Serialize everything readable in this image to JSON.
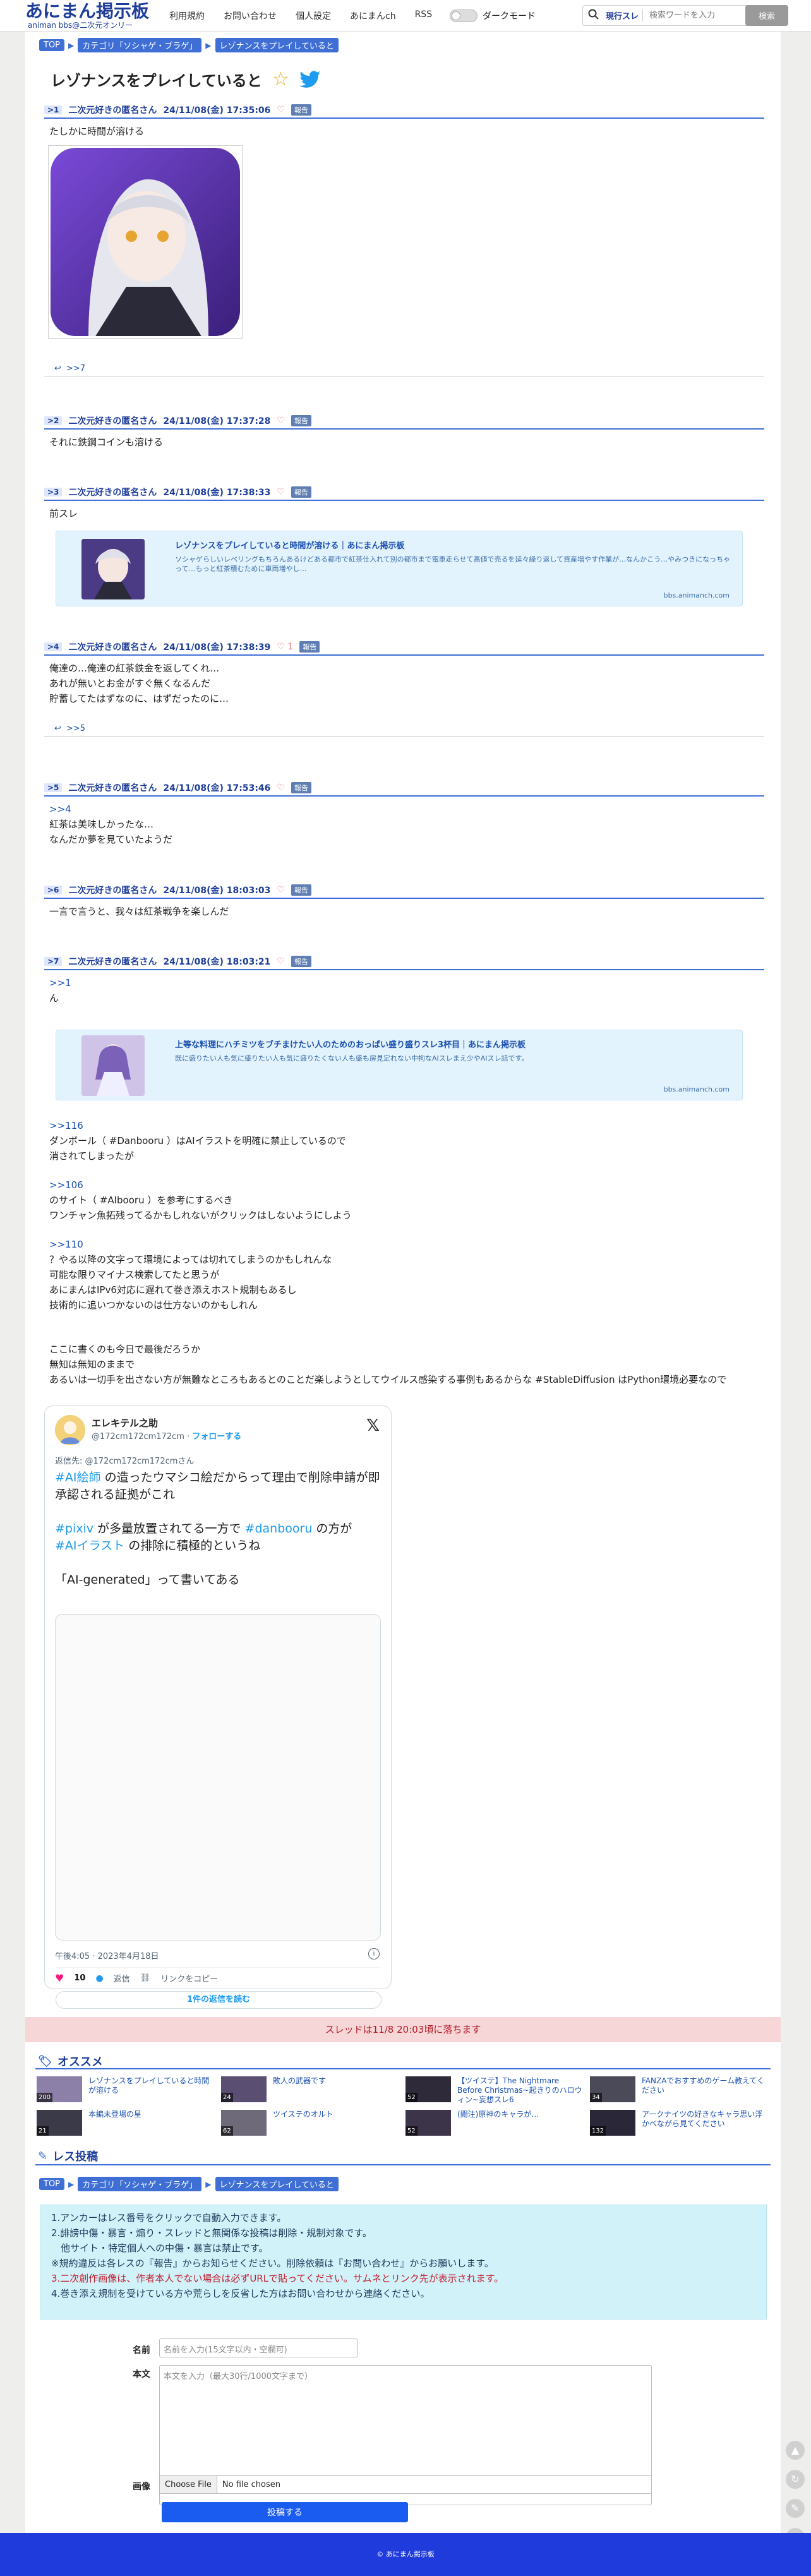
{
  "header": {
    "logo_main": "あにまん掲示板",
    "logo_sub": "animan bbs@二次元オンリー",
    "nav": [
      "利用規約",
      "お問い合わせ",
      "個人設定",
      "あにまんch",
      "RSS"
    ],
    "dark_mode_label": "ダークモード",
    "search_scope": "現行スレ",
    "search_placeholder": "検索ワードを入力",
    "search_button": "検索"
  },
  "breadcrumb": [
    "TOP",
    "カテゴリ「ソシャゲ・ブラゲ」",
    "レゾナンスをプレイしていると"
  ],
  "thread": {
    "title": "レゾナンスをプレイしていると"
  },
  "posts": [
    {
      "num": ">1",
      "name": "二次元好きの匿名さん",
      "date": "24/11/08(金) 17:35:06",
      "likes": "",
      "report": "報告",
      "body": "たしかに時間が溶ける",
      "replies": ">>7"
    },
    {
      "num": ">2",
      "name": "二次元好きの匿名さん",
      "date": "24/11/08(金) 17:37:28",
      "likes": "",
      "report": "報告",
      "body": "それに鉄鋼コインも溶ける"
    },
    {
      "num": ">3",
      "name": "二次元好きの匿名さん",
      "date": "24/11/08(金) 17:38:33",
      "likes": "",
      "report": "報告",
      "body": "前スレ"
    },
    {
      "num": ">4",
      "name": "二次元好きの匿名さん",
      "date": "24/11/08(金) 17:38:39",
      "likes": "1",
      "report": "報告",
      "body": "俺達の…俺達の紅茶鉄金を返してくれ…\nあれが無いとお金がすぐ無くなるんだ\n貯蓄してたはずなのに、はずだったのに…",
      "replies": ">>5"
    },
    {
      "num": ">5",
      "name": "二次元好きの匿名さん",
      "date": "24/11/08(金) 17:53:46",
      "likes": "",
      "report": "報告",
      "anchor": ">>4",
      "body": "紅茶は美味しかったな…\nなんだか夢を見ていたようだ"
    },
    {
      "num": ">6",
      "name": "二次元好きの匿名さん",
      "date": "24/11/08(金) 18:03:03",
      "likes": "",
      "report": "報告",
      "body": "一言で言うと、我々は紅茶戦争を楽しんだ"
    },
    {
      "num": ">7",
      "name": "二次元好きの匿名さん",
      "date": "24/11/08(金) 18:03:21",
      "likes": "",
      "report": "報告",
      "anchor": ">>1",
      "body": "ん"
    }
  ],
  "card1": {
    "title": "レゾナンスをプレイしていると時間が溶ける｜あにまん掲示板",
    "desc": "ソシャゲらしいレベリングもちろんあるけどある都市で紅茶仕入れて別の都市まで電車走らせて高値で売るを延々繰り返して資産増やす作業が…なんかこう…やみつきになっちゃって…もっと紅茶積むために車両増やし…",
    "domain": "bbs.animanch.com"
  },
  "card2": {
    "title": "上等な料理にハチミツをブチまけたい人のためのおっぱい盛り盛りスレ3杯目｜あにまん掲示板",
    "desc": "既に盛りたい人も気に盛りたい人も気に盛りたくない人も盛も房見定れない中拘なAIスレまえ少やAIスレ話です。",
    "domain": "bbs.animanch.com"
  },
  "post7_extra": [
    {
      "anchor": ">>116",
      "lines": "ダンボール（ #Danbooru ）はAIイラストを明確に禁止しているので\n消されてしまったが"
    },
    {
      "anchor": ">>106",
      "lines": "のサイト（ #AIbooru ）を参考にするべき\nワンチャン魚拓残ってるかもしれないがクリックはしないようにしよう"
    },
    {
      "anchor": ">>110",
      "lines": "？やる以降の文字って環境によっては切れてしまうのかもしれんな\n可能な限りマイナス検索してたと思うが\nあにまんはIPv6対応に遅れて巻き添えホスト規制もあるし\n技術的に追いつかないのは仕方ないのかもしれん"
    },
    {
      "anchor": "",
      "lines": "ここに書くのも今日で最後だろうか\n無知は無知のままで\nあるいは一切手を出さない方が無難なところもあるとのことだ楽しようとしてウイルス感染する事例もあるからな #StableDiffusion はPython環境必要なので"
    }
  ],
  "tweet": {
    "name": "エレキテル之助",
    "handle": "@172cm172cm172cm",
    "follow": "フォローする",
    "reply_to_label": "返信先:",
    "reply_to": "@172cm172cm172cmさん",
    "tag_aieshi": "#AI絵師",
    "text1": " の造ったウマシコ絵だからって理由で削除申請が即承認される証拠がこれ",
    "tag_pixiv": "#pixiv",
    "text2": " が多量放置されてる一方で ",
    "tag_danbooru": "#danbooru",
    "text3": " の方が",
    "tag_aiillust": "#AIイラスト",
    "text4": " の排除に積極的というね",
    "quote": "「AI-generated」って書いてある",
    "time": "午後4:05 · 2023年4月18日",
    "likes": "10",
    "reply_label": "返信",
    "copy_label": "リンクをコピー",
    "read_replies": "1件の返信を読む"
  },
  "expire_notice": "スレッドは11/8 20:03頃に落ちます",
  "recommend": {
    "heading": "オススメ",
    "items": [
      {
        "title": "レゾナンスをプレイしていると時間が溶ける",
        "count": "200"
      },
      {
        "title": "敗人の武器です",
        "count": "24"
      },
      {
        "title": "【ツイステ】The Nightmare Before Christmas~起きりのハロウィン~妄想スレ6",
        "count": "52"
      },
      {
        "title": "FANZAでおすすめのゲーム教えてください",
        "count": "34"
      },
      {
        "title": "本編未登場の星",
        "count": "21"
      },
      {
        "title": "ツイステのオルト",
        "count": "62"
      },
      {
        "title": "(閲注)原神のキャラが…",
        "count": "52"
      },
      {
        "title": "アークナイツの好きなキャラ思い浮かべながら見てください",
        "count": "132"
      }
    ]
  },
  "post_form": {
    "heading": "レス投稿",
    "rules": [
      "1.アンカーはレス番号をクリックで自動入力できます。",
      "2.誹謗中傷・暴言・煽り・スレッドと無関係な投稿は削除・規制対象です。",
      "　他サイト・特定個人への中傷・暴言は禁止です。",
      "※規約違反は各レスの『報告』からお知らせください。削除依頼は『お問い合わせ』からお願いします。",
      "3.二次創作画像は、作者本人でない場合は必ずURLで貼ってください。サムネとリンク先が表示されます。",
      "4.巻き添え規制を受けている方や荒らしを反省した方はお問い合わせから連絡ください。"
    ],
    "name_label": "名前",
    "name_placeholder": "名前を入力(15文字以内・空欄可)",
    "body_label": "本文",
    "body_placeholder": "本文を入力（最大30行/1000文字まで）",
    "image_label": "画像",
    "file_button": "Choose File",
    "file_status": "No file chosen",
    "submit": "投稿する"
  },
  "footer": {
    "text": "© あにまん掲示板"
  },
  "colors": {
    "accent": "#3f6fd5",
    "brand": "#1e3e9a",
    "footer": "#1f3bdc",
    "alert_bg": "#f6d6d7",
    "rules_bg": "#d2f2fa"
  }
}
